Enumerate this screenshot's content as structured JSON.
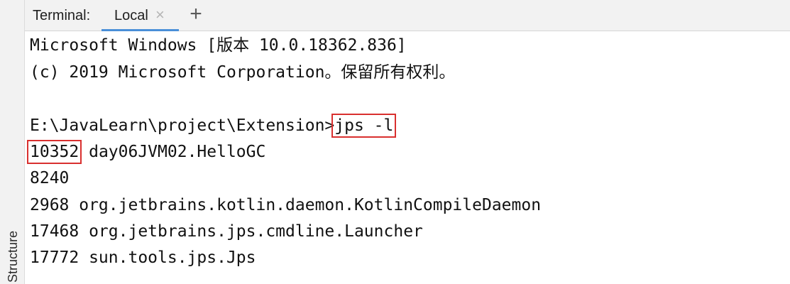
{
  "tab_bar": {
    "title": "Terminal:",
    "active_tab": "Local",
    "close_glyph": "×",
    "add_glyph": "+"
  },
  "side_strip": {
    "label": "Structure"
  },
  "terminal": {
    "lines": [
      "Microsoft Windows [版本 10.0.18362.836]",
      "(c) 2019 Microsoft Corporation。保留所有权利。",
      "",
      "E:\\JavaLearn\\project\\Extension>",
      "",
      "8240",
      "2968 org.jetbrains.kotlin.daemon.KotlinCompileDaemon",
      "17468 org.jetbrains.jps.cmdline.Launcher",
      "17772 sun.tools.jps.Jps"
    ],
    "prompt": "E:\\JavaLearn\\project\\Extension>",
    "command": "jps -l",
    "highlight_pid": "10352",
    "highlight_rest": " day06JVM02.HelloGC"
  },
  "colors": {
    "highlight_box": "#d9302f",
    "tab_underline": "#4a8fd8"
  },
  "icons": {
    "close": "close-icon",
    "add": "plus-icon"
  }
}
